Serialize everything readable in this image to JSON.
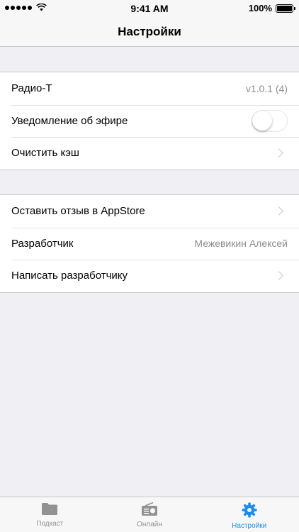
{
  "status_bar": {
    "time": "9:41 AM",
    "battery": "100%"
  },
  "nav": {
    "title": "Настройки"
  },
  "group1": {
    "app_name_label": "Радио-Т",
    "app_version": "v1.0.1 (4)",
    "notification_label": "Уведомление об эфире",
    "notification_enabled": false,
    "clear_cache_label": "Очистить кэш"
  },
  "group2": {
    "review_label": "Оставить отзыв в AppStore",
    "developer_label": "Разработчик",
    "developer_name": "Межевикин Алексей",
    "write_developer_label": "Написать разработчику"
  },
  "tabs": [
    {
      "label": "Подкаст",
      "icon": "folder-icon",
      "active": false
    },
    {
      "label": "Онлайн",
      "icon": "radio-icon",
      "active": false
    },
    {
      "label": "Настройки",
      "icon": "gear-icon",
      "active": true
    }
  ],
  "colors": {
    "accent": "#1a8cf0",
    "inactive": "#929292",
    "background": "#efeff4"
  }
}
